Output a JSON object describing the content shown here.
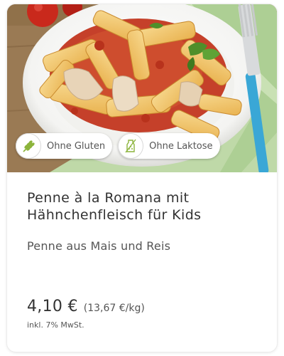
{
  "product": {
    "badges": [
      {
        "label": "Ohne Gluten",
        "icon": "wheat-crossed-icon"
      },
      {
        "label": "Ohne Laktose",
        "icon": "milk-bottle-crossed-icon"
      }
    ],
    "title_line1": "Penne à la Romana mit",
    "title_line2": "Hähnchenfleisch für Kids",
    "subtitle": "Penne aus Mais und Reis",
    "price": "4,10 €",
    "unit_price": "(13,67 €/kg)",
    "tax_note": "inkl. 7% MwSt."
  },
  "colors": {
    "badge_icon_green": "#8cb43c",
    "napkin_green": "#bfd9a8",
    "fork_handle": "#3aa7d6"
  }
}
